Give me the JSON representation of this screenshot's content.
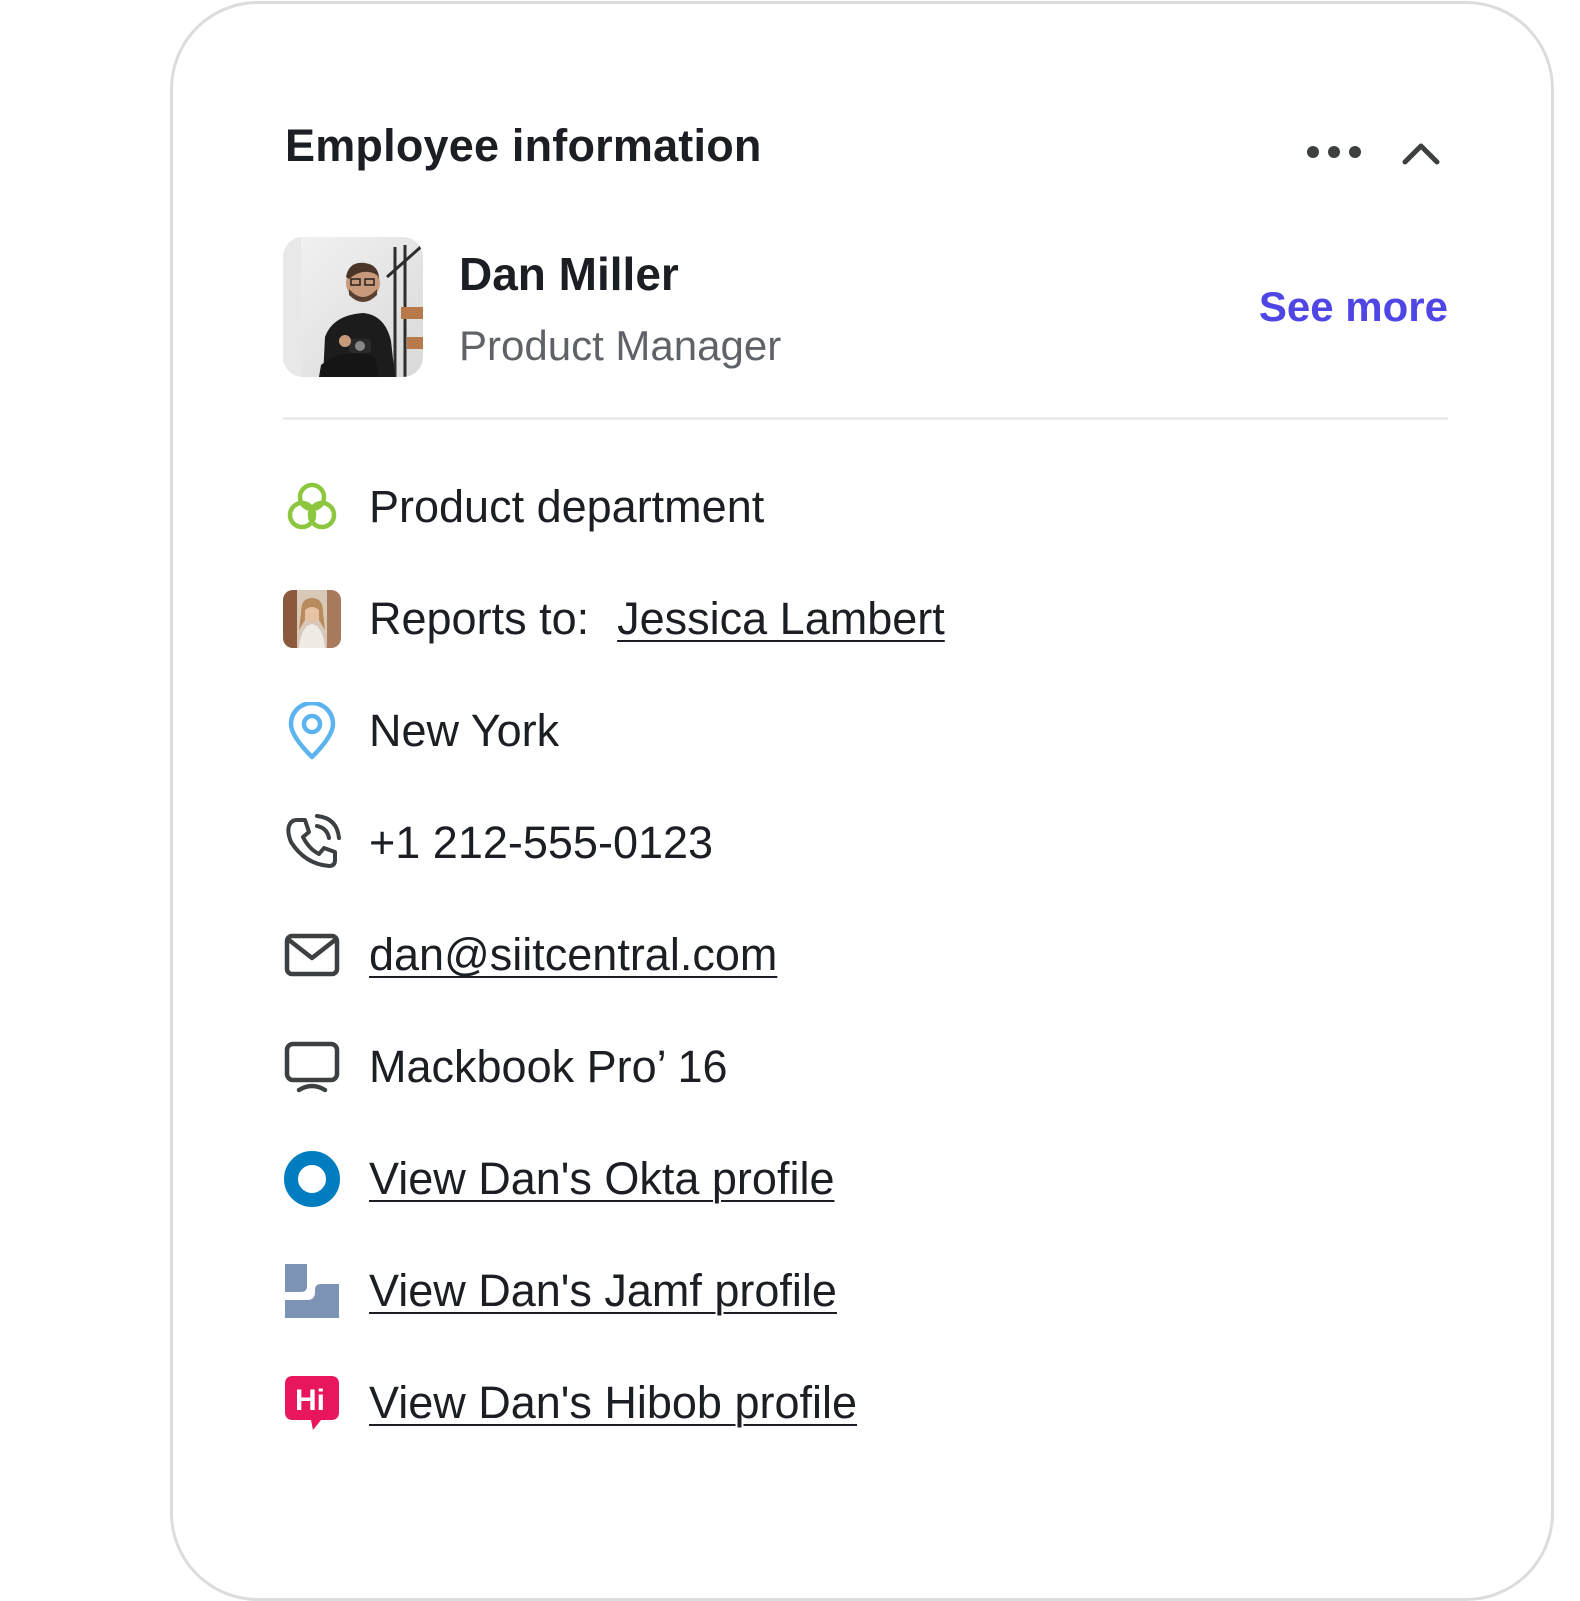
{
  "card": {
    "title": "Employee information",
    "more_icon": "more-horizontal-icon",
    "collapse_icon": "chevron-up-icon"
  },
  "profile": {
    "name": "Dan Miller",
    "role": "Product Manager",
    "see_more_label": "See more",
    "see_more_color": "#4f46e5"
  },
  "info": {
    "department": {
      "icon": "department-icon",
      "color": "#8dc63f",
      "text": "Product department"
    },
    "reports_to": {
      "icon": "manager-avatar",
      "label": "Reports to:",
      "name": "Jessica Lambert"
    },
    "location": {
      "icon": "location-pin-icon",
      "color": "#5bb4f0",
      "text": "New York"
    },
    "phone": {
      "icon": "phone-icon",
      "text": "+1 212-555-0123"
    },
    "email": {
      "icon": "mail-icon",
      "text": "dan@siitcentral.com"
    },
    "device": {
      "icon": "laptop-icon",
      "text": "Mackbook Pro’ 16"
    },
    "okta": {
      "icon": "okta-logo-icon",
      "color": "#007dc1",
      "text": "View Dan's Okta profile"
    },
    "jamf": {
      "icon": "jamf-logo-icon",
      "color": "#7d93b5",
      "text": "View Dan's Jamf profile"
    },
    "hibob": {
      "icon": "hibob-logo-icon",
      "color": "#e8175d",
      "text": "View Dan's Hibob profile"
    }
  }
}
